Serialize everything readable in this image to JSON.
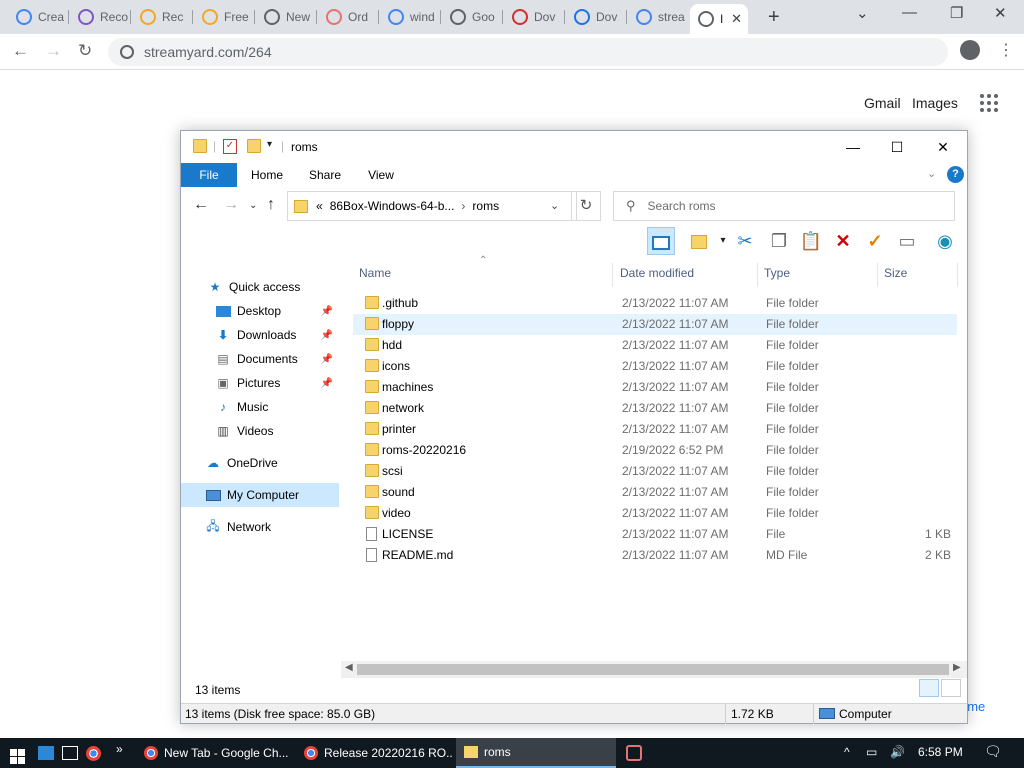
{
  "browser": {
    "tabs": [
      {
        "label": "Crea",
        "favicon": "google-icon",
        "color": "#4285f4"
      },
      {
        "label": "Reco",
        "favicon": "doc-icon",
        "color": "#7e57c2"
      },
      {
        "label": "Rec",
        "favicon": "emoji-icon",
        "color": "#f5a623"
      },
      {
        "label": "Free",
        "favicon": "emoji-icon",
        "color": "#f5a623"
      },
      {
        "label": "New",
        "favicon": "chrome-icon",
        "color": "#5f6368"
      },
      {
        "label": "Ord",
        "favicon": "flower-icon",
        "color": "#e57373"
      },
      {
        "label": "wind",
        "favicon": "google-icon",
        "color": "#4285f4"
      },
      {
        "label": "Goo",
        "favicon": "chrome-icon",
        "color": "#5f6368"
      },
      {
        "label": "Dov",
        "favicon": "m-icon",
        "color": "#d32f2f"
      },
      {
        "label": "Dov",
        "favicon": "download-icon",
        "color": "#1a73e8"
      },
      {
        "label": "strea",
        "favicon": "google-icon",
        "color": "#4285f4"
      },
      {
        "label": "I",
        "favicon": "chrome-icon",
        "color": "#5f6368"
      }
    ],
    "url": "streamyard.com/264"
  },
  "google": {
    "gmail": "Gmail",
    "images": "Images",
    "peek": "ome"
  },
  "explorer": {
    "title": "roms",
    "ribbon_tabs": [
      "File",
      "Home",
      "Share",
      "View"
    ],
    "address_prefix": "«",
    "address_parent": "86Box-Windows-64-b...",
    "address_current": "roms",
    "search_placeholder": "Search roms",
    "nav": {
      "quick_access": "Quick access",
      "desktop": "Desktop",
      "downloads": "Downloads",
      "documents": "Documents",
      "pictures": "Pictures",
      "music": "Music",
      "videos": "Videos",
      "onedrive": "OneDrive",
      "my_computer": "My Computer",
      "network": "Network"
    },
    "columns": {
      "name": "Name",
      "date": "Date modified",
      "type": "Type",
      "size": "Size"
    },
    "files": [
      {
        "name": ".github",
        "date": "2/13/2022 11:07 AM",
        "type": "File folder",
        "size": ""
      },
      {
        "name": "floppy",
        "date": "2/13/2022 11:07 AM",
        "type": "File folder",
        "size": ""
      },
      {
        "name": "hdd",
        "date": "2/13/2022 11:07 AM",
        "type": "File folder",
        "size": ""
      },
      {
        "name": "icons",
        "date": "2/13/2022 11:07 AM",
        "type": "File folder",
        "size": ""
      },
      {
        "name": "machines",
        "date": "2/13/2022 11:07 AM",
        "type": "File folder",
        "size": ""
      },
      {
        "name": "network",
        "date": "2/13/2022 11:07 AM",
        "type": "File folder",
        "size": ""
      },
      {
        "name": "printer",
        "date": "2/13/2022 11:07 AM",
        "type": "File folder",
        "size": ""
      },
      {
        "name": "roms-20220216",
        "date": "2/19/2022 6:52 PM",
        "type": "File folder",
        "size": ""
      },
      {
        "name": "scsi",
        "date": "2/13/2022 11:07 AM",
        "type": "File folder",
        "size": ""
      },
      {
        "name": "sound",
        "date": "2/13/2022 11:07 AM",
        "type": "File folder",
        "size": ""
      },
      {
        "name": "video",
        "date": "2/13/2022 11:07 AM",
        "type": "File folder",
        "size": ""
      },
      {
        "name": "LICENSE",
        "date": "2/13/2022 11:07 AM",
        "type": "File",
        "size": "1 KB"
      },
      {
        "name": "README.md",
        "date": "2/13/2022 11:07 AM",
        "type": "MD File",
        "size": "2 KB"
      }
    ],
    "item_count": "13 items",
    "status_left": "13 items (Disk free space: 85.0 GB)",
    "status_size": "1.72 KB",
    "status_location": "Computer"
  },
  "taskbar": {
    "apps": [
      {
        "label": "New Tab - Google Ch...",
        "icon": "chrome-icon"
      },
      {
        "label": "Release 20220216 RO...",
        "icon": "chrome-icon"
      },
      {
        "label": "roms",
        "icon": "folder-icon"
      }
    ],
    "time": "6:58 PM"
  },
  "colors": {
    "accent": "#1979ca",
    "folder": "#f7d46b",
    "selection": "#cce8ff",
    "hover": "#e5f3ff",
    "taskbar": "#101820"
  }
}
